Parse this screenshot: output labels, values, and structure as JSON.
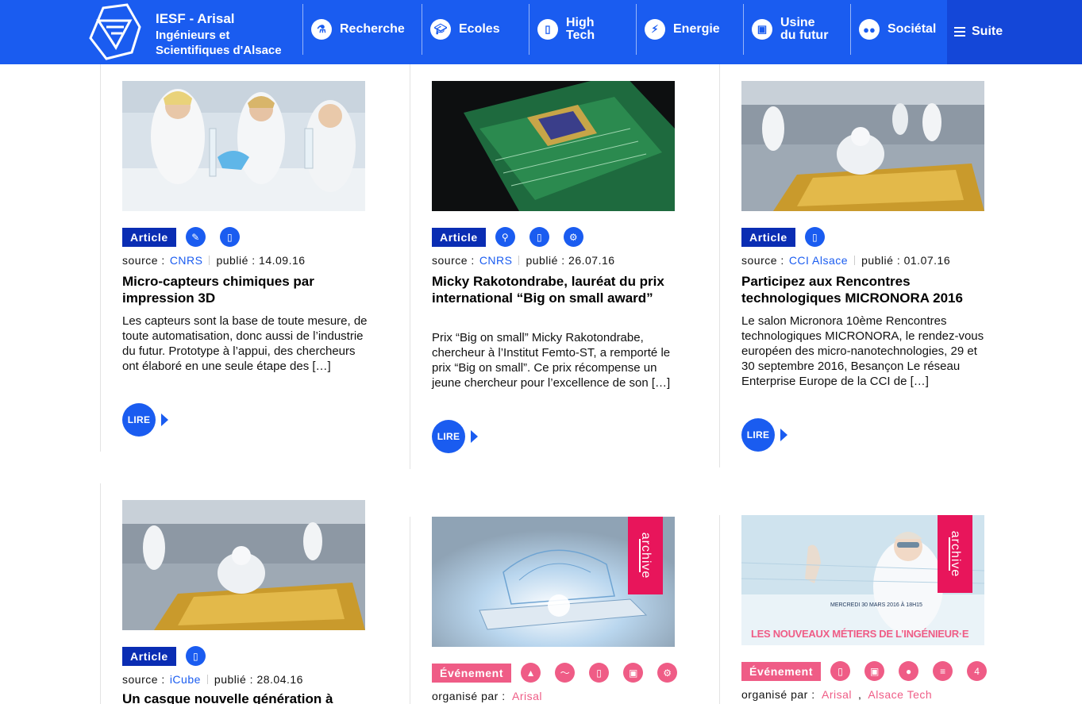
{
  "header": {
    "brand_title": "IESF - Arisal",
    "brand_subtitle": "Ingénieurs et\nScientifiques d'Alsace",
    "nav": [
      {
        "label": "Recherche",
        "icon": "flask-icon"
      },
      {
        "label": "Ecoles",
        "icon": "graduation-cap-icon"
      },
      {
        "label": "High\nTech",
        "icon": "smartphone-icon"
      },
      {
        "label": "Energie",
        "icon": "lightning-icon"
      },
      {
        "label": "Usine\ndu futur",
        "icon": "factory-icon"
      },
      {
        "label": "Sociétal",
        "icon": "people-icon"
      }
    ],
    "more_label": "Suite",
    "colors": {
      "bar": "#1a5cf0",
      "more": "#1447d8"
    }
  },
  "labels": {
    "source": "source :",
    "published": "publié :",
    "organised_by": "organisé par :",
    "read_more": "LIRE",
    "archive": "archive"
  },
  "cards": [
    {
      "type": "Article",
      "categories": [
        "pipette-icon",
        "smartphone-icon"
      ],
      "source": "CNRS",
      "date": "14.09.16",
      "title": "Micro-capteurs chimiques par impression 3D",
      "excerpt": "Les capteurs sont la base de toute mesure, de toute automatisation, donc aussi de l’industrie du futur. Prototype à l’appui, des chercheurs ont élaboré en une seule étape des […]"
    },
    {
      "type": "Article",
      "categories": [
        "plug-icon",
        "smartphone-icon",
        "robot-arm-icon"
      ],
      "source": "CNRS",
      "date": "26.07.16",
      "title": "Micky Rakotondrabe, lauréat du prix international “Big on small award”",
      "excerpt": "Prix “Big on small” Micky Rakotondrabe, chercheur à l’Institut Femto-ST, a remporté le prix  “Big on small”. Ce prix récompense un jeune chercheur pour l’excellence de son […]"
    },
    {
      "type": "Article",
      "categories": [
        "smartphone-icon"
      ],
      "source": "CCI Alsace",
      "date": "01.07.16",
      "title": "Participez aux Rencontres technologiques MICRONORA 2016",
      "excerpt": "Le salon Micronora 10ème Rencontres technologiques MICRONORA, le rendez-vous européen des micro-nanotechnologies, 29 et 30 septembre 2016, Besançon Le réseau Enterprise Europe de la CCI de […]"
    },
    {
      "type": "Article",
      "categories": [
        "smartphone-icon"
      ],
      "source": "iCube",
      "date": "28.04.16",
      "title": "Un casque nouvelle génération à"
    },
    {
      "type": "Événement",
      "categories": [
        "graduation-cap-icon",
        "trend-icon",
        "smartphone-icon",
        "factory-icon",
        "robot-arm-icon"
      ],
      "organisers": [
        "Arisal"
      ]
    },
    {
      "type": "Événement",
      "categories": [
        "smartphone-icon",
        "factory-icon",
        "lightbulb-icon",
        "circuit-icon",
        "factory-4-icon"
      ],
      "organisers": [
        "Arisal",
        "Alsace Tech"
      ],
      "image_text": {
        "date_line": "MERCREDI 30 MARS 2016 À 18H15",
        "headline": "LES NOUVEAUX MÉTIERS DE L’INGÉNIEUR·E"
      }
    }
  ],
  "colors": {
    "accent": "#1a5cf0",
    "badge": "#0a2db3",
    "event": "#ef5c86",
    "archive": "#e8155b"
  }
}
